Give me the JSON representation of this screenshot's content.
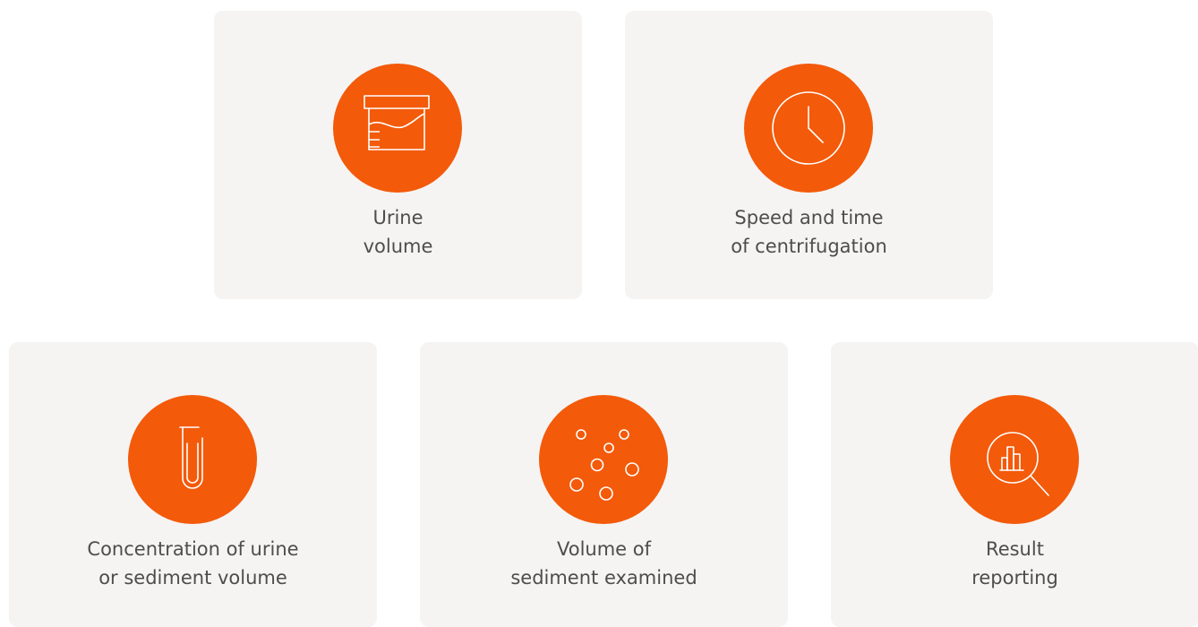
{
  "cards": [
    {
      "icon": "urine-container-icon",
      "line1": "Urine",
      "line2": "volume"
    },
    {
      "icon": "clock-icon",
      "line1": "Speed and time",
      "line2": "of centrifugation"
    },
    {
      "icon": "test-tube-icon",
      "line1": "Concentration of urine",
      "line2": "or sediment volume"
    },
    {
      "icon": "particles-icon",
      "line1": "Volume of",
      "line2": "sediment examined"
    },
    {
      "icon": "chart-magnifier-icon",
      "line1": "Result",
      "line2": "reporting"
    }
  ],
  "colors": {
    "accent": "#f35a0a",
    "card_bg": "#f5f4f3",
    "text": "#4d4d4d"
  }
}
